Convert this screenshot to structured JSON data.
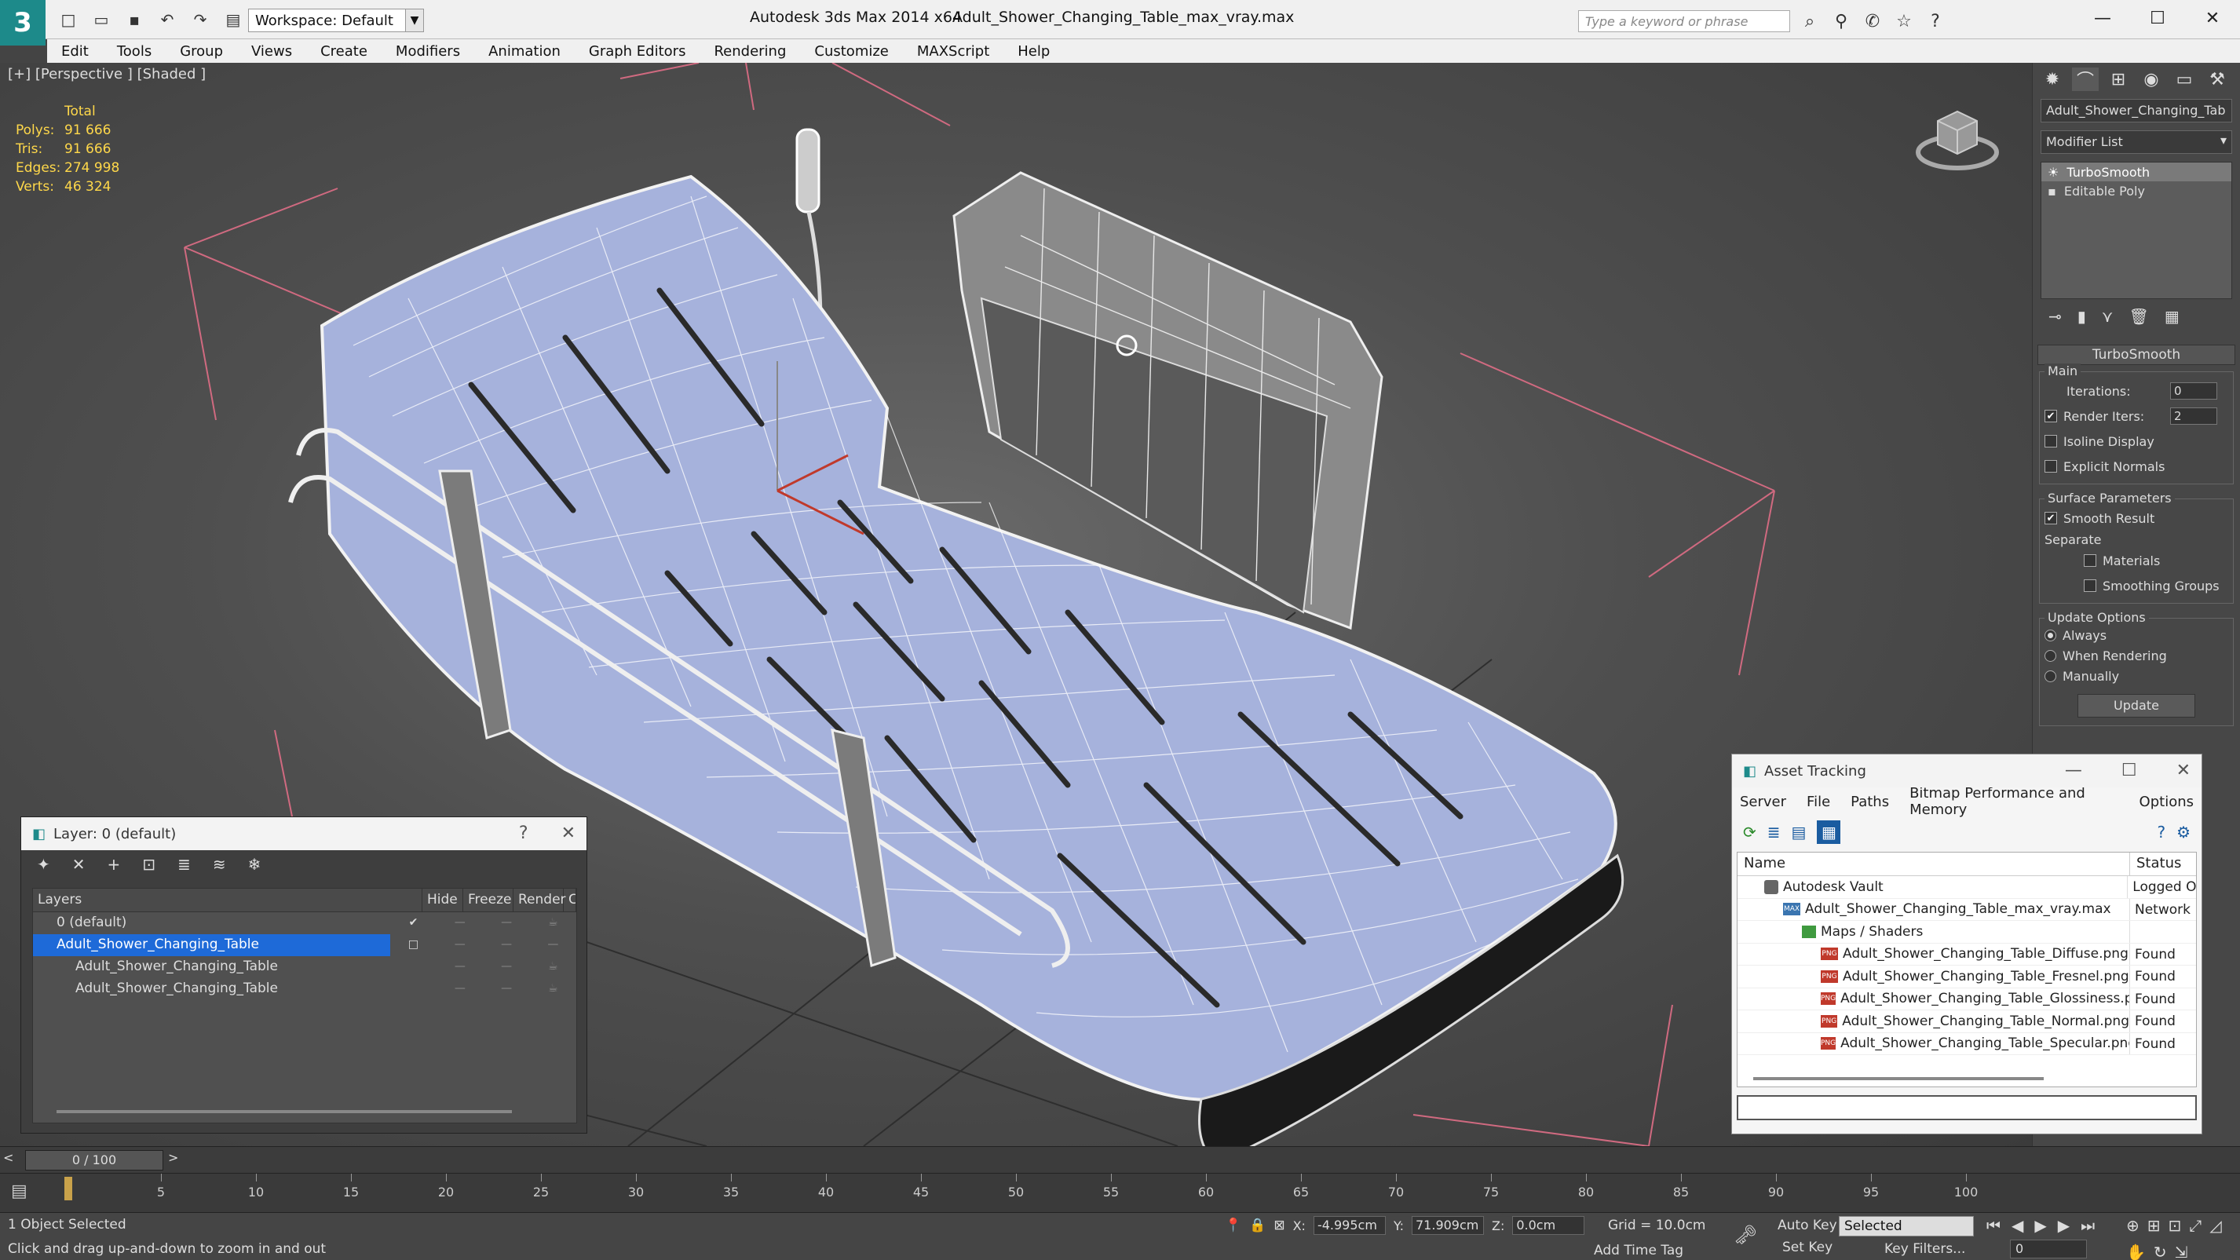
{
  "titlebar": {
    "app_title": "Autodesk 3ds Max  2014 x64",
    "file_title": "Adult_Shower_Changing_Table_max_vray.max",
    "workspace": "Workspace: Default",
    "search_placeholder": "Type a keyword or phrase"
  },
  "menu": [
    "Edit",
    "Tools",
    "Group",
    "Views",
    "Create",
    "Modifiers",
    "Animation",
    "Graph Editors",
    "Rendering",
    "Customize",
    "MAXScript",
    "Help"
  ],
  "viewport": {
    "label": "[+] [Perspective ] [Shaded ]",
    "stats": {
      "total_label": "Total",
      "polys_label": "Polys:",
      "polys": "91 666",
      "tris_label": "Tris:",
      "tris": "91 666",
      "edges_label": "Edges:",
      "edges": "274 998",
      "verts_label": "Verts:",
      "verts": "46 324"
    }
  },
  "command_panel": {
    "object_name": "Adult_Shower_Changing_Tab",
    "modifier_list": "Modifier List",
    "stack": [
      "TurboSmooth",
      "Editable Poly"
    ],
    "rollout_title": "TurboSmooth",
    "main_group": "Main",
    "iterations_label": "Iterations:",
    "iterations": "0",
    "render_iters_label": "Render Iters:",
    "render_iters": "2",
    "isoline_label": "Isoline Display",
    "explicit_normals_label": "Explicit Normals",
    "surface_group": "Surface Parameters",
    "smooth_result_label": "Smooth Result",
    "separate_label": "Separate",
    "materials_label": "Materials",
    "smoothing_groups_label": "Smoothing Groups",
    "update_group": "Update Options",
    "always_label": "Always",
    "when_rendering_label": "When Rendering",
    "manually_label": "Manually",
    "update_button": "Update"
  },
  "layer_dialog": {
    "title": "Layer: 0 (default)",
    "help": "?",
    "columns": [
      "Layers",
      "Hide",
      "Freeze",
      "Render",
      "C"
    ],
    "rows": [
      {
        "name": "0 (default)",
        "level": 0,
        "selected": false
      },
      {
        "name": "Adult_Shower_Changing_Table",
        "level": 0,
        "selected": true
      },
      {
        "name": "Adult_Shower_Changing_Table",
        "level": 1,
        "selected": false
      },
      {
        "name": "Adult_Shower_Changing_Table",
        "level": 1,
        "selected": false
      }
    ]
  },
  "asset_dialog": {
    "title": "Asset Tracking",
    "menu": [
      "Server",
      "File",
      "Paths",
      "Bitmap Performance and Memory",
      "Options"
    ],
    "col_name": "Name",
    "col_status": "Status",
    "rows": [
      {
        "name": "Autodesk Vault",
        "status": "Logged O",
        "icon": "vault",
        "indent": 1
      },
      {
        "name": "Adult_Shower_Changing_Table_max_vray.max",
        "status": "Network",
        "icon": "max",
        "indent": 2
      },
      {
        "name": "Maps / Shaders",
        "status": "",
        "icon": "folder",
        "indent": 3
      },
      {
        "name": "Adult_Shower_Changing_Table_Diffuse.png",
        "status": "Found",
        "icon": "png",
        "indent": 4
      },
      {
        "name": "Adult_Shower_Changing_Table_Fresnel.png",
        "status": "Found",
        "icon": "png",
        "indent": 4
      },
      {
        "name": "Adult_Shower_Changing_Table_Glossiness.png",
        "status": "Found",
        "icon": "png",
        "indent": 4
      },
      {
        "name": "Adult_Shower_Changing_Table_Normal.png",
        "status": "Found",
        "icon": "png",
        "indent": 4
      },
      {
        "name": "Adult_Shower_Changing_Table_Specular.png",
        "status": "Found",
        "icon": "png",
        "indent": 4
      }
    ]
  },
  "timeline": {
    "frame": "0 / 100",
    "prev": "<",
    "next": ">",
    "ticks": [
      5,
      10,
      15,
      20,
      25,
      30,
      35,
      40,
      45,
      50,
      55,
      60,
      65,
      70,
      75,
      80,
      85,
      90,
      95,
      100
    ]
  },
  "status": {
    "selection": "1 Object Selected",
    "prompt": "Click and drag up-and-down to zoom in and out",
    "x_label": "X:",
    "x": "-4.995cm",
    "y_label": "Y:",
    "y": "71.909cm",
    "z_label": "Z:",
    "z": "0.0cm",
    "grid": "Grid = 10.0cm",
    "add_time_tag": "Add Time Tag",
    "auto_key": "Auto Key",
    "set_key": "Set Key",
    "selected_dropdown": "Selected",
    "key_filters": "Key Filters...",
    "frame_field": "0"
  }
}
